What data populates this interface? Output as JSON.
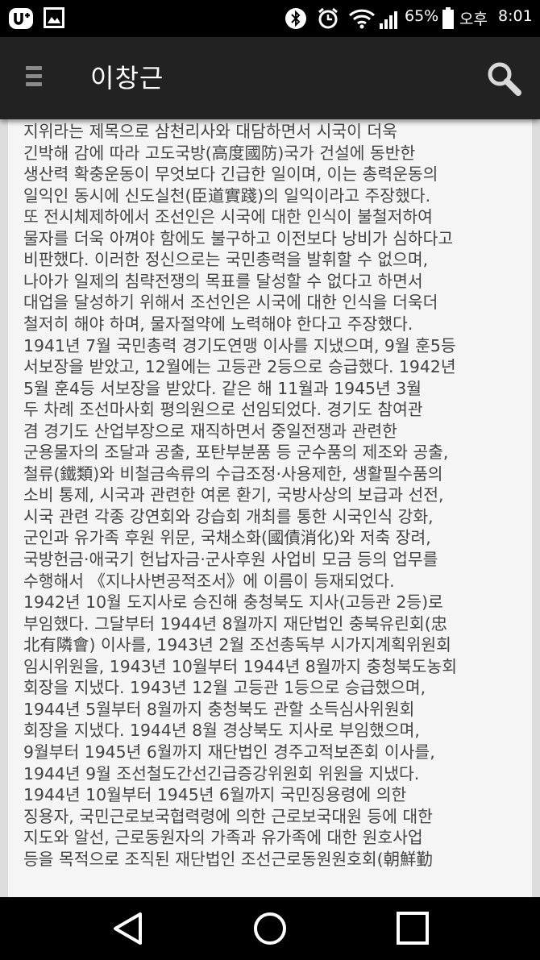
{
  "status_bar": {
    "battery_percent": "65%",
    "ampm": "오후",
    "time": "8:01",
    "icons": [
      "u-plus-logo-icon",
      "gallery-icon",
      "bluetooth-icon",
      "alarm-icon",
      "wifi-icon",
      "signal-icon",
      "battery-icon"
    ]
  },
  "app_bar": {
    "title": "이창근",
    "menu_icon": "hamburger-menu-icon",
    "search_icon": "search-icon"
  },
  "article": {
    "lines": [
      "지위라는 제목으로 삼천리사와 대담하면서 시국이 더욱",
      "긴박해 감에 따라 고도국방(高度國防)국가 건설에 동반한",
      "생산력 확충운동이 무엇보다 긴급한 일이며, 이는 총력운동의",
      "일익인 동시에 신도실천(臣道實踐)의 일익이라고 주장했다.",
      "또 전시체제하에서 조선인은 시국에 대한 인식이 불철저하여",
      "물자를 더욱 아껴야 함에도 불구하고 이전보다 낭비가 심하다고",
      "비판했다. 이러한 정신으로는 국민총력을 발휘할 수 없으며,",
      "나아가 일제의 침략전쟁의 목표를 달성할 수 없다고 하면서",
      "대업을 달성하기 위해서 조선인은 시국에 대한 인식을 더욱더",
      "철저히 해야 하며, 물자절약에 노력해야 한다고 주장했다.",
      "1941년 7월 국민총력 경기도연맹 이사를 지냈으며, 9월 훈5등",
      "서보장을 받았고, 12월에는 고등관 2등으로 승급했다. 1942년",
      "5월 훈4등 서보장을 받았다. 같은 해 11월과 1945년 3월",
      "두 차례 조선마사회 평의원으로 선임되었다. 경기도 참여관",
      "겸 경기도 산업부장으로 재직하면서 중일전쟁과 관련한",
      "군용물자의 조달과 공출, 포탄부분품 등 군수품의 제조와 공출,",
      "철류(鐵類)와 비철금속류의 수급조정·사용제한, 생활필수품의",
      "소비 통제, 시국과 관련한 여론 환기, 국방사상의 보급과 선전,",
      "시국 관련 각종 강연회와 강습회 개최를 통한 시국인식 강화,",
      "군인과 유가족 후원 위문, 국채소화(國債消化)와 저축 장려,",
      "국방헌금·애국기 헌납자금·군사후원 사업비 모금 등의 업무를",
      "수행해서 《지나사변공적조서》에 이름이 등재되었다.",
      "1942년 10월 도지사로 승진해 충청북도 지사(고등관 2등)로",
      "부임했다. 그달부터 1944년 8월까지 재단법인 충북유린회(忠",
      "北有隣會) 이사를, 1943년 2월 조선총독부 시가지계획위원회",
      "임시위원을, 1943년 10월부터 1944년 8월까지 충청북도농회",
      "회장을 지냈다. 1943년 12월 고등관 1등으로 승급했으며,",
      "1944년 5월부터 8월까지 충청북도 관할 소득심사위원회",
      "회장을 지냈다. 1944년 8월 경상북도 지사로 부임했으며,",
      "9월부터 1945년 6월까지 재단법인 경주고적보존회 이사를,",
      "1944년 9월 조선철도간선긴급증강위원회 위원을 지냈다.",
      "1944년 10월부터 1945년 6월까지 국민징용령에 의한",
      "징용자, 국민근로보국협력령에 의한 근로보국대원 등에 대한",
      "지도와 알선, 근로동원자의 가족과 유가족에 대한 원호사업",
      "등을 목적으로 조직된 재단법인 조선근로동원원호회(朝鮮勤"
    ]
  },
  "nav_bar": {
    "icons": [
      "back-triangle-icon",
      "home-circle-icon",
      "recents-square-icon"
    ]
  }
}
